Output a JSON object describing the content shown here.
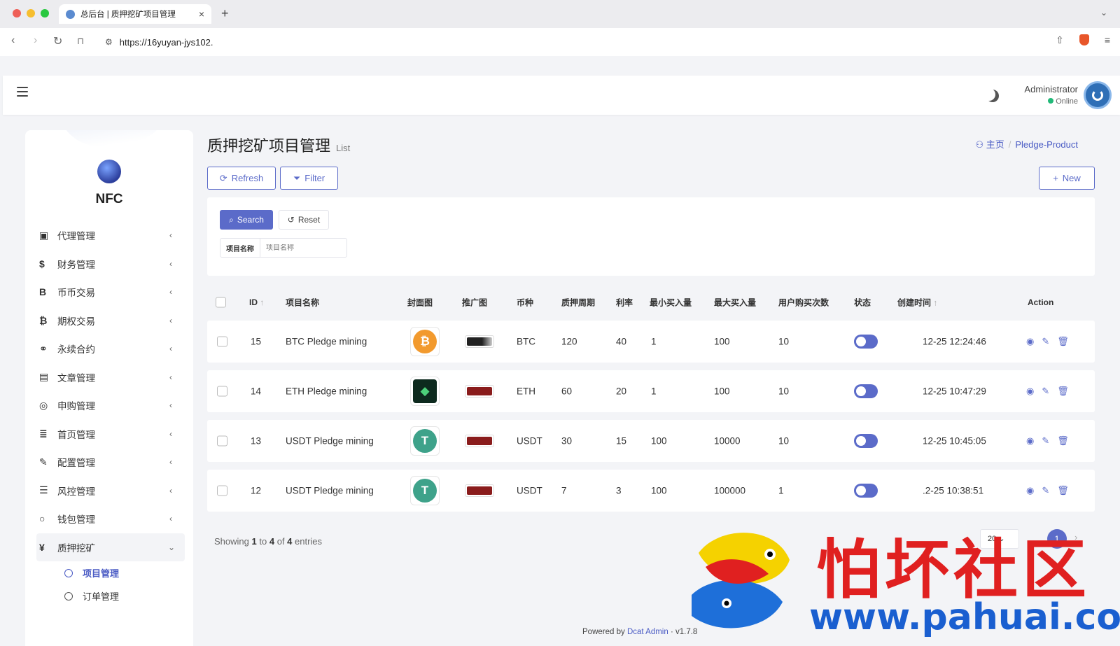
{
  "browser": {
    "tab_title": "总后台 | 质押挖矿项目管理",
    "tab_close": "×",
    "new_tab": "+",
    "url": "https://16yuyan-jys102."
  },
  "header": {
    "user_name": "Administrator",
    "user_status": "Online"
  },
  "sidebar": {
    "logo_text": "NFC",
    "items": [
      {
        "icon": "▣",
        "label": "代理管理"
      },
      {
        "icon": "$",
        "label": "财务管理"
      },
      {
        "icon": "B",
        "label": "币币交易"
      },
      {
        "icon": "₿",
        "label": "期权交易"
      },
      {
        "icon": "⚭",
        "label": "永续合约"
      },
      {
        "icon": "▤",
        "label": "文章管理"
      },
      {
        "icon": "◎",
        "label": "申购管理"
      },
      {
        "icon": "≣",
        "label": "首页管理"
      },
      {
        "icon": "✎",
        "label": "配置管理"
      },
      {
        "icon": "☰",
        "label": "风控管理"
      },
      {
        "icon": "○",
        "label": "钱包管理"
      },
      {
        "icon": "¥",
        "label": "质押挖矿"
      }
    ],
    "sub_items": [
      "项目管理",
      "订单管理"
    ]
  },
  "page": {
    "title": "质押挖矿项目管理",
    "subtitle": "List",
    "breadcrumb_home": "主页",
    "breadcrumb_sep": "/",
    "breadcrumb_current": "Pledge-Product",
    "refresh_label": "Refresh",
    "filter_label": "Filter",
    "new_label": "New"
  },
  "filter": {
    "search_label": "Search",
    "reset_label": "Reset",
    "field_label": "项目名称",
    "field_placeholder": "项目名称"
  },
  "table": {
    "headers": {
      "id": "ID",
      "name": "项目名称",
      "cover": "封面图",
      "promo": "推广图",
      "currency": "币种",
      "period": "质押周期",
      "rate": "利率",
      "min_buy": "最小买入量",
      "max_buy": "最大买入量",
      "user_buys": "用户购买次数",
      "status": "状态",
      "created": "创建时间",
      "action": "Action"
    },
    "rows": [
      {
        "id": "15",
        "name": "BTC Pledge mining",
        "coin": "btc",
        "currency": "BTC",
        "period": "120",
        "rate": "40",
        "min_buy": "1",
        "max_buy": "100",
        "user_buys": "10",
        "created": "12-25 12:24:46"
      },
      {
        "id": "14",
        "name": "ETH Pledge mining",
        "coin": "eth",
        "currency": "ETH",
        "period": "60",
        "rate": "20",
        "min_buy": "1",
        "max_buy": "100",
        "user_buys": "10",
        "created": "12-25 10:47:29"
      },
      {
        "id": "13",
        "name": "USDT Pledge mining",
        "coin": "usdt",
        "currency": "USDT",
        "period": "30",
        "rate": "15",
        "min_buy": "100",
        "max_buy": "10000",
        "user_buys": "10",
        "created": "12-25 10:45:05"
      },
      {
        "id": "12",
        "name": "USDT Pledge mining",
        "coin": "usdt",
        "currency": "USDT",
        "period": "7",
        "rate": "3",
        "min_buy": "100",
        "max_buy": "100000",
        "user_buys": "1",
        "created": ".2-25 10:38:51"
      }
    ]
  },
  "pagination": {
    "showing_prefix": "Showing",
    "from": "1",
    "to_word": "to",
    "to": "4",
    "of_word": "of",
    "total": "4",
    "entries_word": "entries",
    "per_page": "20",
    "current_page": "1"
  },
  "footer": {
    "powered_by": "Powered by",
    "brand": "Dcat Admin",
    "sep": "·",
    "version": "v1.7.8"
  },
  "watermark": {
    "text": "怕坏社区",
    "url": "www.pahuai.com"
  },
  "colors": {
    "accent": "#5b6bc9",
    "online": "#21b978",
    "watermark_red": "#e02020",
    "watermark_blue": "#1a5fd0"
  }
}
